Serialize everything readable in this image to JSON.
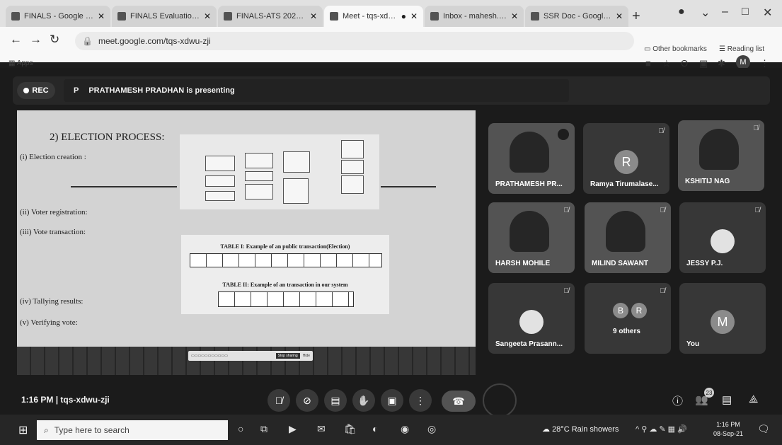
{
  "browser": {
    "tabs": [
      {
        "label": "FINALS - Google Drive",
        "active": false
      },
      {
        "label": "FINALS Evaluation She",
        "active": false
      },
      {
        "label": "FINALS-ATS 2020-20...",
        "active": false
      },
      {
        "label": "Meet - tqs-xdwu",
        "active": true
      },
      {
        "label": "Inbox - mahesh.angri...",
        "active": false
      },
      {
        "label": "SSR Doc - Google Do...",
        "active": false
      }
    ],
    "url": "meet.google.com/tqs-xdwu-zji",
    "apps_label": "Apps",
    "other_bookmarks": "Other bookmarks",
    "reading_list": "Reading list",
    "profile_initial": "M"
  },
  "meet": {
    "rec_label": "REC",
    "presenter_initial": "P",
    "presenter_text": "PRATHAMESH PRADHAN is presenting",
    "slide": {
      "heading": "2) ELECTION PROCESS:",
      "items": [
        "(i)  Election creation :",
        "(ii) Voter registration:",
        "(iii) Vote transaction:",
        "(iv) Tallying results:",
        "(v) Verifying vote:"
      ],
      "table1_caption": "TABLE I: Example of an public transaction(Election)",
      "table2_caption": "TABLE II: Example of an transaction in our system",
      "share_stop": "Stop sharing",
      "share_hide": "Hide"
    },
    "tiles": [
      {
        "name": "PRATHAMESH PR...",
        "type": "video"
      },
      {
        "name": "Ramya Tirumalase...",
        "type": "avatar",
        "initial": "R"
      },
      {
        "name": "KSHITIJ NAG",
        "type": "video"
      },
      {
        "name": "HARSH MOHILE",
        "type": "video"
      },
      {
        "name": "MILIND SAWANT",
        "type": "video"
      },
      {
        "name": "JESSY P.J.",
        "type": "photo"
      },
      {
        "name": "Sangeeta Prasann...",
        "type": "photo"
      },
      {
        "name": "9 others",
        "type": "group",
        "initials": [
          "B",
          "R"
        ]
      },
      {
        "name": "You",
        "type": "avatar",
        "initial": "M"
      }
    ],
    "time": "1:16 PM",
    "separator": "|",
    "meeting_code": "tqs-xdwu-zji",
    "participant_count": "23"
  },
  "taskbar": {
    "search_placeholder": "Type here to search",
    "weather": "28°C  Rain showers",
    "clock_time": "1:16 PM",
    "clock_date": "08-Sep-21"
  }
}
